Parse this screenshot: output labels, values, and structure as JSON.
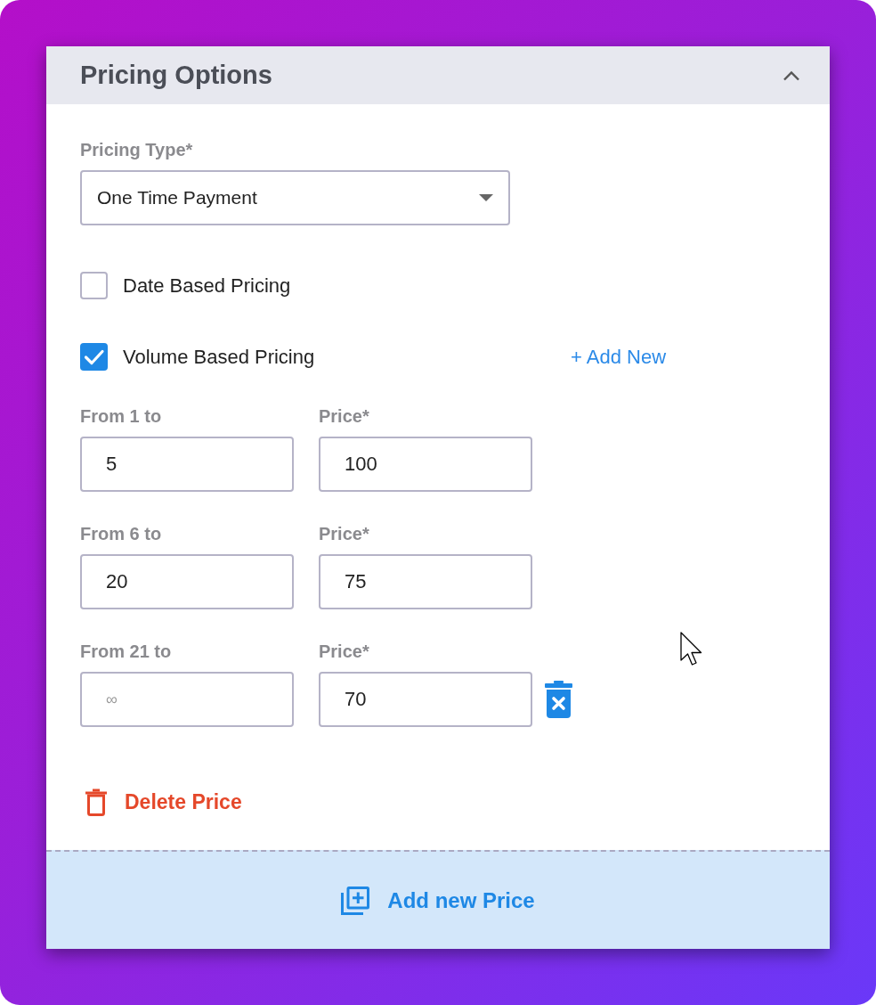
{
  "panel": {
    "title": "Pricing Options",
    "expanded": true
  },
  "pricing_type": {
    "label": "Pricing Type*",
    "value": "One Time Payment"
  },
  "options": [
    {
      "label": "Date Based Pricing",
      "checked": false
    },
    {
      "label": "Volume Based Pricing",
      "checked": true,
      "action": "+ Add New"
    }
  ],
  "tiers": [
    {
      "range_label": "From 1 to",
      "to_value": "5",
      "price_label": "Price*",
      "price_value": "100",
      "removable": false
    },
    {
      "range_label": "From 6 to",
      "to_value": "20",
      "price_label": "Price*",
      "price_value": "75",
      "removable": false
    },
    {
      "range_label": "From 21 to",
      "to_placeholder": "∞",
      "price_label": "Price*",
      "price_value": "70",
      "removable": true
    }
  ],
  "delete_button": "Delete Price",
  "footer_button": "Add new Price"
}
